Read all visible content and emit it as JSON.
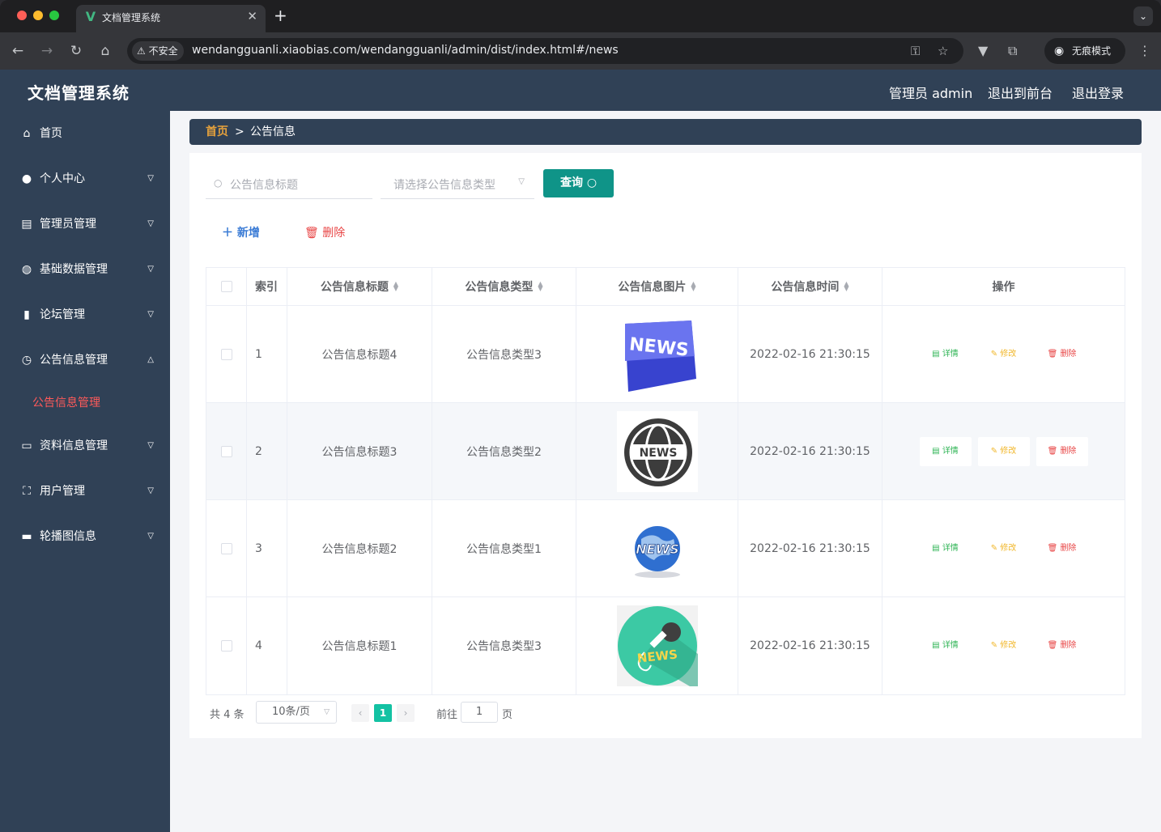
{
  "browser": {
    "tab_title": "文档管理系统",
    "insecure_label": "不安全",
    "url": "wendangguanli.xiaobias.com/wendangguanli/admin/dist/index.html#/news",
    "incognito_label": "无痕模式"
  },
  "header": {
    "title": "文档管理系统",
    "user": "管理员 admin",
    "exit_front": "退出到前台",
    "logout": "退出登录"
  },
  "sidebar": {
    "items": [
      {
        "label": "首页",
        "icon": "home-icon"
      },
      {
        "label": "个人中心",
        "icon": "user-icon"
      },
      {
        "label": "管理员管理",
        "icon": "briefcase-icon"
      },
      {
        "label": "基础数据管理",
        "icon": "lightbulb-icon"
      },
      {
        "label": "论坛管理",
        "icon": "bar-chart-icon"
      },
      {
        "label": "公告信息管理",
        "icon": "clock-icon"
      },
      {
        "label": "资料信息管理",
        "icon": "card-icon"
      },
      {
        "label": "用户管理",
        "icon": "frame-icon"
      },
      {
        "label": "轮播图信息",
        "icon": "monitor-icon"
      }
    ],
    "active_sub": "公告信息管理"
  },
  "breadcrumb": {
    "home": "首页",
    "separator": ">",
    "current": "公告信息"
  },
  "filters": {
    "title_placeholder": "公告信息标题",
    "type_placeholder": "请选择公告信息类型",
    "query_label": "查询"
  },
  "actions": {
    "add_label": "新增",
    "delete_label": "删除"
  },
  "table": {
    "headers": {
      "index": "索引",
      "title": "公告信息标题",
      "type": "公告信息类型",
      "image": "公告信息图片",
      "time": "公告信息时间",
      "ops": "操作"
    },
    "op_labels": {
      "detail": "详情",
      "edit": "修改",
      "delete": "删除"
    },
    "rows": [
      {
        "index": "1",
        "title": "公告信息标题4",
        "type": "公告信息类型3",
        "image_text": "NEWS",
        "time": "2022-02-16 21:30:15"
      },
      {
        "index": "2",
        "title": "公告信息标题3",
        "type": "公告信息类型2",
        "image_text": "NEWS",
        "time": "2022-02-16 21:30:15"
      },
      {
        "index": "3",
        "title": "公告信息标题2",
        "type": "公告信息类型1",
        "image_text": "NEWS",
        "time": "2022-02-16 21:30:15"
      },
      {
        "index": "4",
        "title": "公告信息标题1",
        "type": "公告信息类型3",
        "image_text": "NEWS",
        "time": "2022-02-16 21:30:15"
      }
    ]
  },
  "pagination": {
    "total": "共 4 条",
    "page_size": "10条/页",
    "current_page": "1",
    "goto": "前往",
    "goto_value": "1",
    "page_suffix": "页"
  },
  "colors": {
    "header_bg": "#304156",
    "accent": "#0f9488",
    "active_menu": "#ff5a5a",
    "breadcrumb_home": "#e6a23c"
  }
}
